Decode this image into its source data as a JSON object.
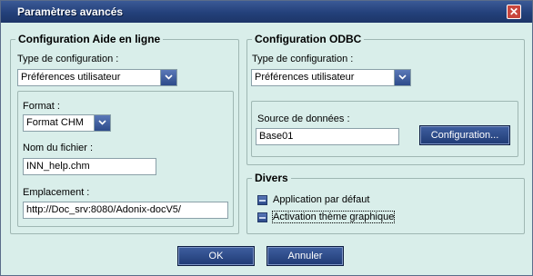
{
  "window": {
    "title": "Paramètres avancés",
    "close_symbol": "✕"
  },
  "aide": {
    "legend": "Configuration Aide en ligne",
    "type_label": "Type de configuration :",
    "type_value": "Préférences utilisateur",
    "format_label": "Format :",
    "format_value": "Format CHM",
    "filename_label": "Nom du fichier :",
    "filename_value": "INN_help.chm",
    "location_label": "Emplacement :",
    "location_value": "http://Doc_srv:8080/Adonix-docV5/"
  },
  "odbc": {
    "legend": "Configuration ODBC",
    "type_label": "Type de configuration :",
    "type_value": "Préférences utilisateur",
    "source_label": "Source de données :",
    "source_value": "Base01",
    "config_button": "Configuration..."
  },
  "divers": {
    "legend": "Divers",
    "option1": "Application par défaut",
    "option2": "Activation thème graphique"
  },
  "footer": {
    "ok": "OK",
    "cancel": "Annuler"
  }
}
